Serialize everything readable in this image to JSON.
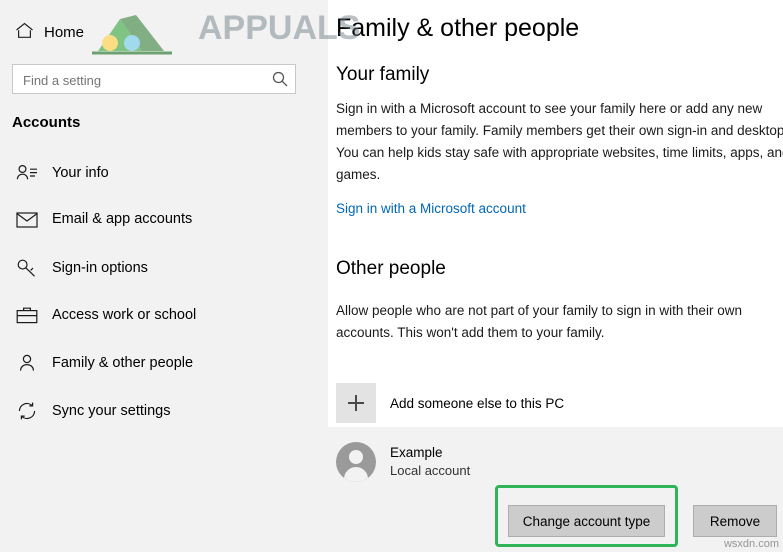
{
  "window": {
    "app": "Settings"
  },
  "nav": {
    "home": {
      "label": "Home",
      "icon": "home-icon"
    },
    "search": {
      "value": "",
      "placeholder": "Find a setting",
      "icon": "search-icon"
    },
    "section_title": "Accounts",
    "items": [
      {
        "label": "Your info",
        "icon": "user-info-icon"
      },
      {
        "label": "Email & app accounts",
        "icon": "mail-icon"
      },
      {
        "label": "Sign-in options",
        "icon": "key-icon"
      },
      {
        "label": "Access work or school",
        "icon": "briefcase-icon"
      },
      {
        "label": "Family & other people",
        "icon": "people-icon",
        "selected": true
      },
      {
        "label": "Sync your settings",
        "icon": "sync-icon"
      }
    ]
  },
  "main": {
    "title": "Family & other people",
    "family": {
      "heading": "Your family",
      "description": "Sign in with a Microsoft account to see your family here or add any new members to your family. Family members get their own sign-in and desktop. You can help kids stay safe with appropriate websites, time limits, apps, and games.",
      "link": "Sign in with a Microsoft account",
      "link_color": "#0067b8"
    },
    "other_people": {
      "heading": "Other people",
      "description": "Allow people who are not part of your family to sign in with their own accounts. This won't add them to your family.",
      "add_label": "Add someone else to this PC",
      "add_icon": "plus-icon",
      "account": {
        "avatar_icon": "avatar-icon",
        "name": "Example",
        "type": "Local account"
      },
      "buttons": {
        "change_account_type": "Change account type",
        "remove": "Remove"
      },
      "highlight_color": "#2fb457"
    }
  },
  "watermarks": {
    "brand": "APPUALS",
    "corner": "wsxdn.com"
  }
}
